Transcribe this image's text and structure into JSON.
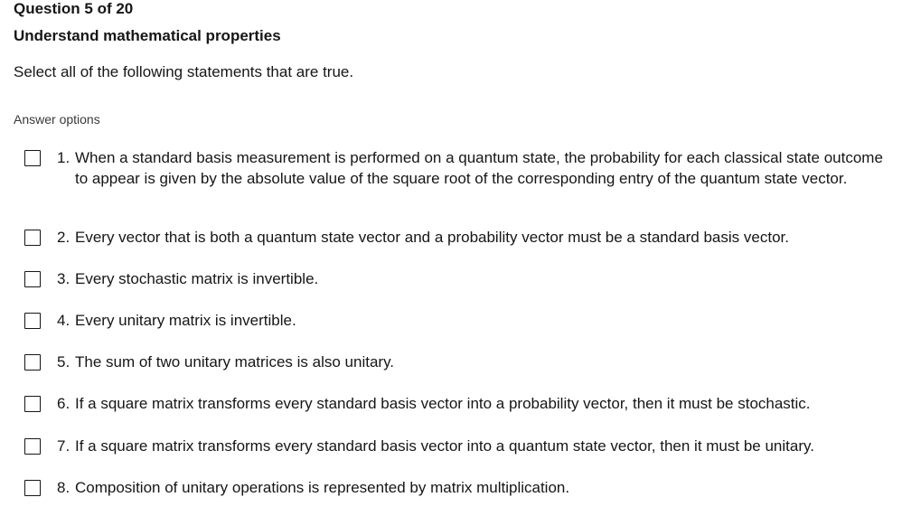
{
  "question": {
    "number_text": "Question 5 of 20",
    "title": "Understand mathematical properties",
    "prompt": "Select all of the following statements that are true."
  },
  "answer_options": {
    "label": "Answer options",
    "items": [
      {
        "number": "1.",
        "text": "When a standard basis measurement is performed on a quantum state, the probability for each classical state outcome to appear is given by the absolute value of the square root of the corresponding entry of the quantum state vector.",
        "checked": false
      },
      {
        "number": "2.",
        "text": "Every vector that is both a quantum state vector and a probability vector must be a standard basis vector.",
        "checked": false
      },
      {
        "number": "3.",
        "text": "Every stochastic matrix is invertible.",
        "checked": false
      },
      {
        "number": "4.",
        "text": "Every unitary matrix is invertible.",
        "checked": false
      },
      {
        "number": "5.",
        "text": "The sum of two unitary matrices is also unitary.",
        "checked": false
      },
      {
        "number": "6.",
        "text": "If a square matrix transforms every standard basis vector into a probability vector, then it must be stochastic.",
        "checked": false
      },
      {
        "number": "7.",
        "text": "If a square matrix transforms every standard basis vector into a quantum state vector, then it must be unitary.",
        "checked": false
      },
      {
        "number": "8.",
        "text": "Composition of unitary operations is represented by matrix multiplication.",
        "checked": false
      }
    ]
  }
}
